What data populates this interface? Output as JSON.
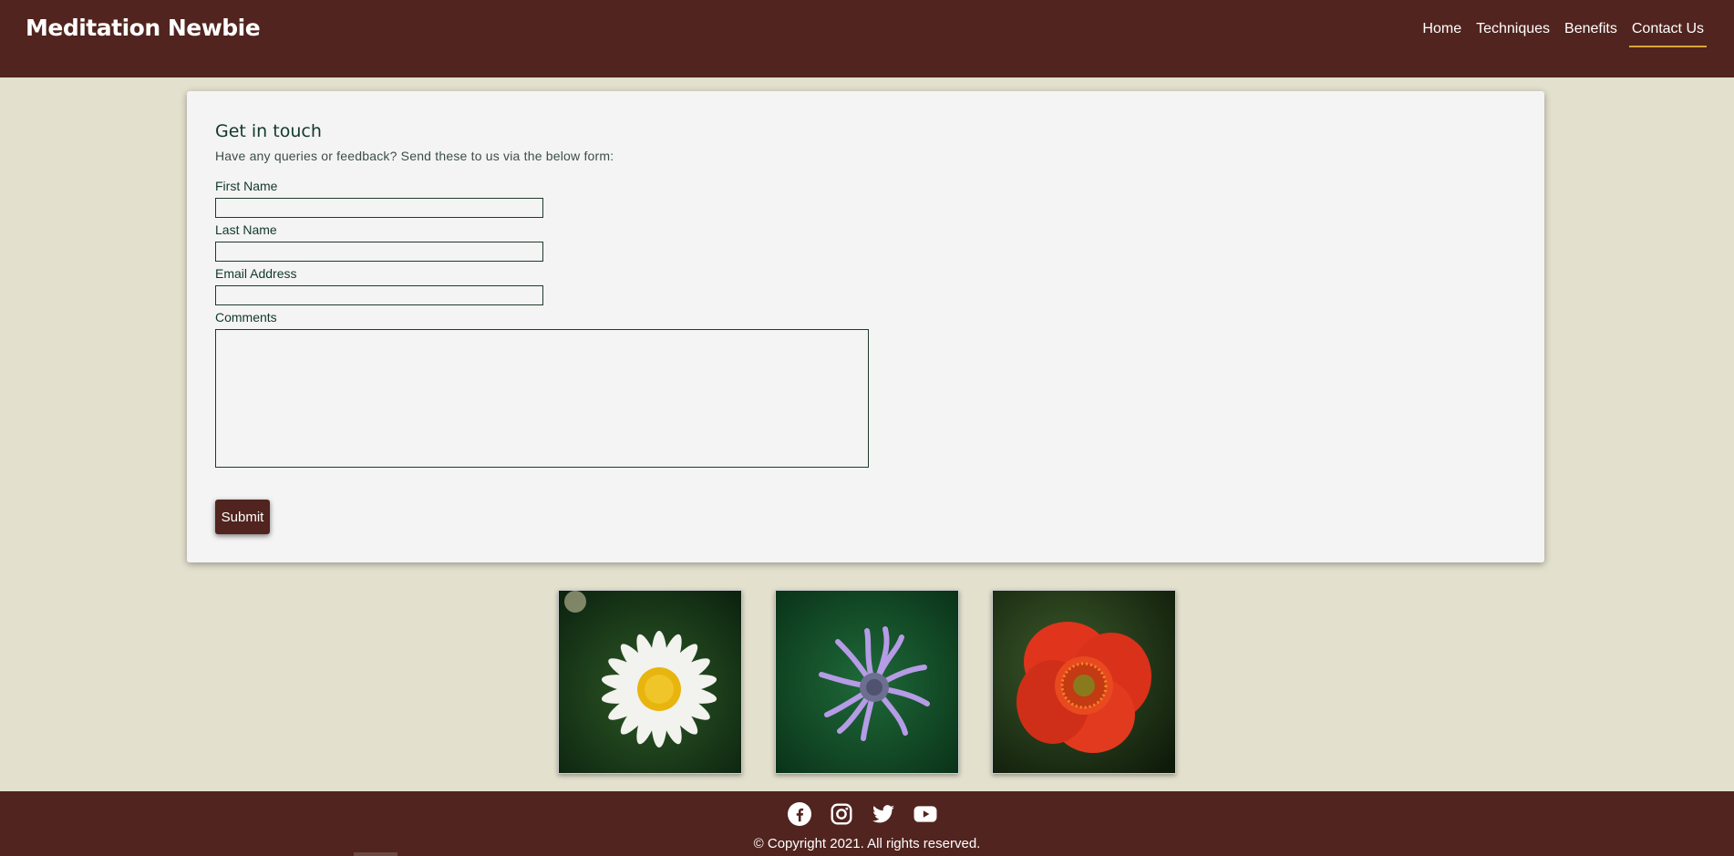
{
  "header": {
    "brand": "Meditation Newbie",
    "nav": [
      "Home",
      "Techniques",
      "Benefits",
      "Contact Us"
    ],
    "active_nav": "Contact Us"
  },
  "form": {
    "title": "Get in touch",
    "intro": "Have any queries or feedback? Send these to us via the below form:",
    "first_name_label": "First Name",
    "first_name_value": "",
    "last_name_label": "Last Name",
    "last_name_value": "",
    "email_label": "Email Address",
    "email_value": "",
    "comments_label": "Comments",
    "comments_value": "",
    "submit_label": "Submit"
  },
  "gallery": {
    "images": [
      "daisy",
      "purple-bee-balm",
      "red-poppy"
    ]
  },
  "footer": {
    "social_icons": [
      "facebook-icon",
      "instagram-icon",
      "twitter-icon",
      "youtube-icon"
    ],
    "copyright": "© Copyright 2021. All rights reserved."
  },
  "colors": {
    "brand_maroon": "#51241f",
    "page_bg": "#e3e0ce",
    "card_bg": "#f4f4f4",
    "text_green": "#12382a",
    "nav_underline": "#d9a53a"
  }
}
